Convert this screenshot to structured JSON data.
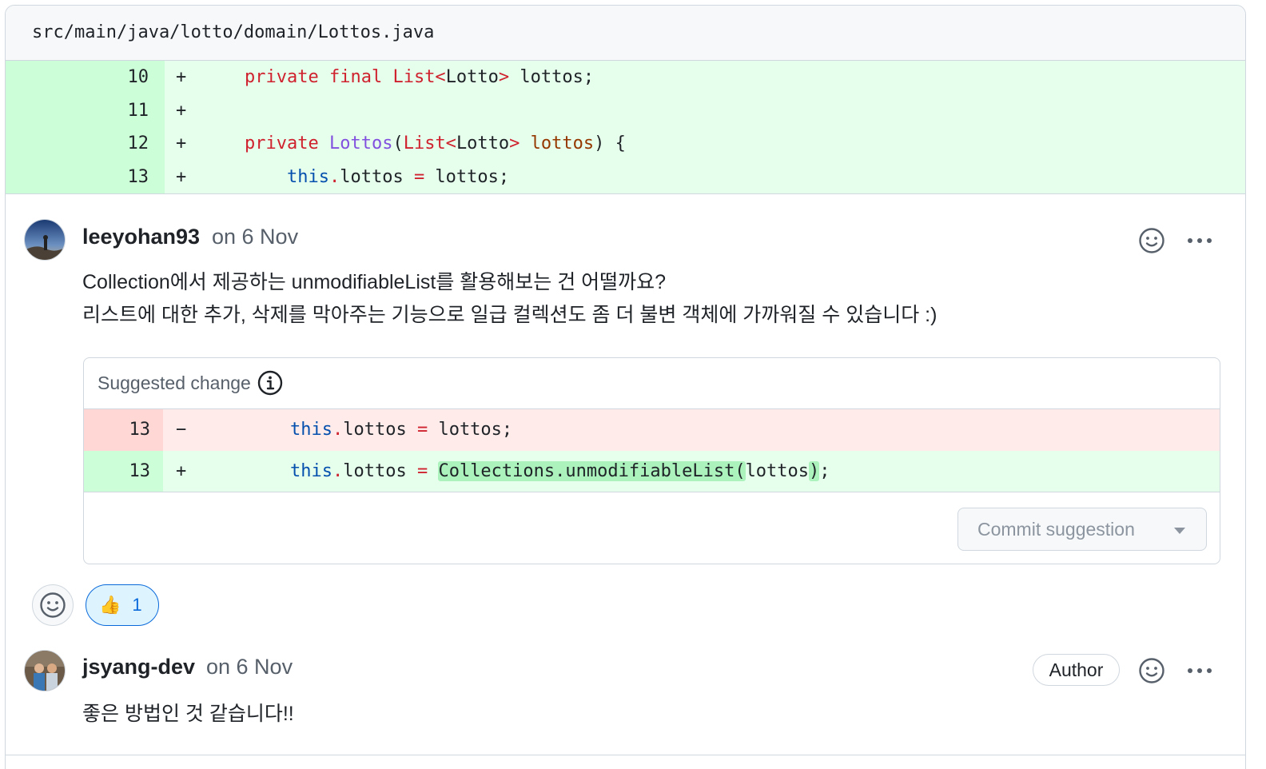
{
  "file": {
    "path": "src/main/java/lotto/domain/Lottos.java"
  },
  "diff": {
    "lines": [
      {
        "num": "10",
        "sign": "+"
      },
      {
        "num": "11",
        "sign": "+"
      },
      {
        "num": "12",
        "sign": "+"
      },
      {
        "num": "13",
        "sign": "+"
      }
    ],
    "code": {
      "l10": {
        "kw1": "private",
        "kw2": "final",
        "type": "List<",
        "inner": "Lotto",
        "close": ">",
        "rest": " lottos;"
      },
      "l12": {
        "kw1": "private",
        "fn": "Lottos",
        "paren": "(",
        "type": "List<",
        "inner": "Lotto",
        "close": ">",
        "param": "lottos",
        "rest": ") {"
      },
      "l13": {
        "this": "this",
        "dot": ".",
        "field": "lottos ",
        "eq": "=",
        "rest": " lottos;"
      }
    }
  },
  "comment1": {
    "author": "leeyohan93",
    "date": "on 6 Nov",
    "line1": "Collection에서 제공하는 unmodifiableList를 활용해보는 건 어떨까요?",
    "line2": "리스트에 대한 추가, 삭제를 막아주는 기능으로 일급 컬렉션도 좀 더 불변 객체에 가까워질 수 있습니다 :)",
    "suggestion": {
      "title": "Suggested change",
      "del": {
        "num": "13",
        "sign": "−",
        "this": "this",
        "dot": ".",
        "field": "lottos ",
        "eq": "=",
        "rest": " lottos;"
      },
      "add": {
        "num": "13",
        "sign": "+",
        "this": "this",
        "dot": ".",
        "field": "lottos ",
        "eq": "=",
        "hl1": "Collections.unmodifiableList(",
        "mid": "lottos",
        "hl2": ")",
        "rest": ";"
      },
      "commit_label": "Commit suggestion"
    },
    "reaction": {
      "emoji": "👍",
      "count": "1"
    }
  },
  "comment2": {
    "author": "jsyang-dev",
    "date": "on 6 Nov",
    "badge": "Author",
    "body": "좋은 방법인 것 같습니다!!"
  },
  "colors": {
    "add_bg": "#e6ffec",
    "add_ln_bg": "#ccffd8",
    "del_bg": "#ffebe9",
    "accent": "#0969da"
  }
}
